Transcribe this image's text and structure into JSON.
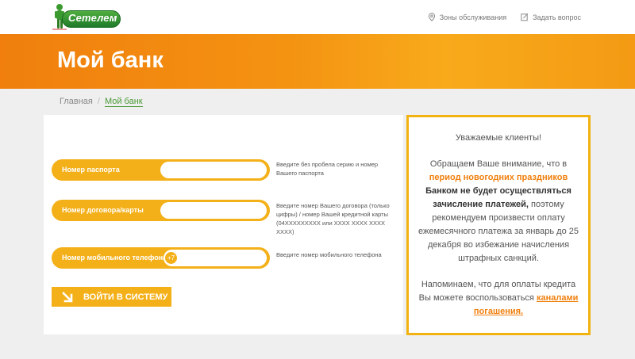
{
  "header": {
    "logo_text": "Сетелем",
    "links": [
      {
        "label": "Зоны обслуживания",
        "icon": "map-pin-icon"
      },
      {
        "label": "Задать вопрос",
        "icon": "edit-icon"
      }
    ]
  },
  "banner": {
    "title": "Мой банк"
  },
  "breadcrumb": {
    "home": "Главная",
    "separator": "/",
    "current": "Мой банк"
  },
  "form": {
    "fields": [
      {
        "label": "Номер паспорта",
        "value": "",
        "hint": "Введите без пробела серию и номер Вашего паспорта"
      },
      {
        "label": "Номер договора/карты",
        "value": "",
        "hint": "Введите номер Вашего договора (только цифры) / номер Вашей кредитной карты (04XXXXXXXXX или XXXX XXXX XXXX XXXX)"
      },
      {
        "label": "Номер мобильного телефона",
        "prefix": "+7",
        "value": "",
        "hint": "Введите номер мобильного телефона"
      }
    ],
    "submit_label": "ВОЙТИ В СИСТЕМУ"
  },
  "notice": {
    "greeting": "Уважаемые клиенты!",
    "p1_start": "Обращаем Ваше внимание, что в ",
    "p1_highlight": "период новогодних праздников",
    "p1_bold": " Банком не будет осуществляться зачисление платежей,",
    "p1_rest": " поэтому рекомендуем произвести оплату ежемесячного платежа за январь до 25 декабря во избежание начисления штрафных санкций.",
    "p2_start": "Напоминаем, что для оплаты кредита Вы можете воспользоваться ",
    "p2_link": "каналами погашения."
  },
  "colors": {
    "accent_orange": "#f07f0d",
    "field_yellow": "#f4b019",
    "notice_border": "#f2b20f",
    "brand_green": "#4a9a36"
  }
}
